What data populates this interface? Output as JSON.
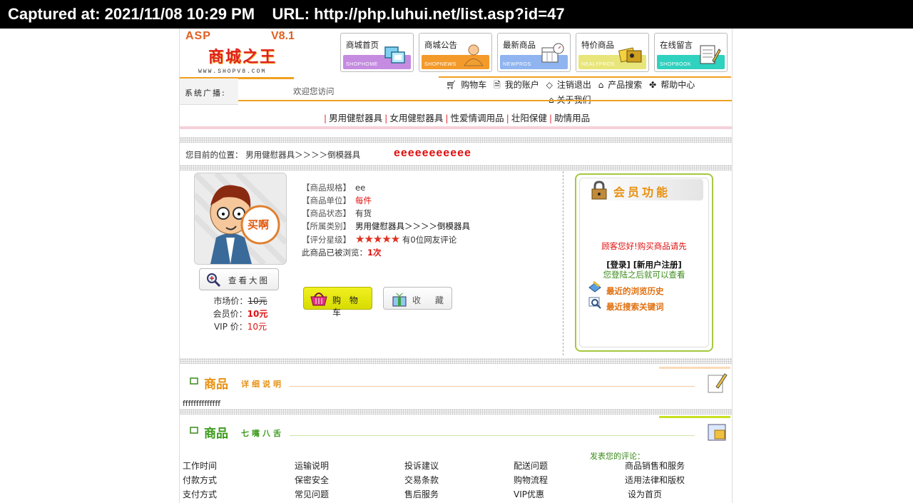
{
  "capture": {
    "text": "Captured at: 2021/11/08 10:29 PM    URL: http://php.luhui.net/list.asp?id=47"
  },
  "logo": {
    "asp": "ASP",
    "version": "V8.1",
    "name": "商城之王",
    "url": "WWW.SHOPV8.COM"
  },
  "nav": [
    {
      "label": "商城首页",
      "band": "SHOPHOME",
      "color": "#c58be0",
      "icon": "windows-icon"
    },
    {
      "label": "商城公告",
      "band": "SHOPNEWS",
      "color": "#f39a2b",
      "icon": "person-icon"
    },
    {
      "label": "最新商品",
      "band": "NEWPROS",
      "color": "#8fb4f0",
      "icon": "calendar-icon"
    },
    {
      "label": "特价商品",
      "band": "NEALYPROS",
      "color": "#e8e67a",
      "icon": "photos-icon"
    },
    {
      "label": "在线留言",
      "band": "SHOPBOOK",
      "color": "#2fd1bf",
      "icon": "notepad-icon"
    }
  ],
  "topbar": {
    "broadcast_label": "系统广播:",
    "welcome": "欢迎您访问",
    "links": [
      "购物车",
      "我的账户",
      "注销退出",
      "产品搜索",
      "帮助中心"
    ],
    "about": "关于我们"
  },
  "categories": [
    "男用健慰器具",
    "女用健慰器具",
    "性爱情调用品",
    "壮阳保健",
    "助情用品"
  ],
  "breadcrumb": {
    "text": "您目前的位置： 男用健慰器具＞＞＞＞倒模器具"
  },
  "product": {
    "title": "eeeeeeeeeee",
    "specs": [
      {
        "key": "【商品规格】",
        "value": "ee"
      },
      {
        "key": "【商品单位】",
        "value": "每件"
      },
      {
        "key": "【商品状态】",
        "value": "有货"
      },
      {
        "key": "【所属类别】",
        "value": "男用健慰器具＞＞＞＞倒模器具"
      }
    ],
    "rating_label": "【评分星级】",
    "rating_stars": 5,
    "rating_text": "有0位网友评论",
    "views_prefix": "此商品已被浏览：",
    "views": "1次",
    "zoom_label": "查看大图",
    "image_badge": "买啊",
    "market_price_label": "市场价：",
    "market_price": "10元",
    "member_price_label": "会员价：",
    "member_price": "10元",
    "vip_price_label": "VIP 价：",
    "vip_price": "10元",
    "cart_label": "购 物 车",
    "fav_label": "收 藏"
  },
  "member": {
    "title": "会员功能",
    "guest": "顾客您好!购买商品请先",
    "login": "[登录]",
    "register": "[新用户注册]",
    "hint": "您登陆之后就可以查看",
    "history": "最近的浏览历史",
    "keywords": "最近搜索关键词"
  },
  "sections": {
    "detail_big": "商品",
    "detail_small": "详细说明",
    "detail_body": "ffffffffffffff",
    "comment_big": "商品",
    "comment_small": "七嘴八舌",
    "comment_note": "发表您的评论："
  },
  "footer": [
    [
      "工作时间",
      "运输说明",
      "投诉建议",
      "配送问题",
      "商品销售和服务"
    ],
    [
      "付款方式",
      "保密安全",
      "交易条款",
      "购物流程",
      "适用法律和版权"
    ],
    [
      "支付方式",
      "常见问题",
      "售后服务",
      "VIP优惠",
      "设为首页"
    ]
  ]
}
